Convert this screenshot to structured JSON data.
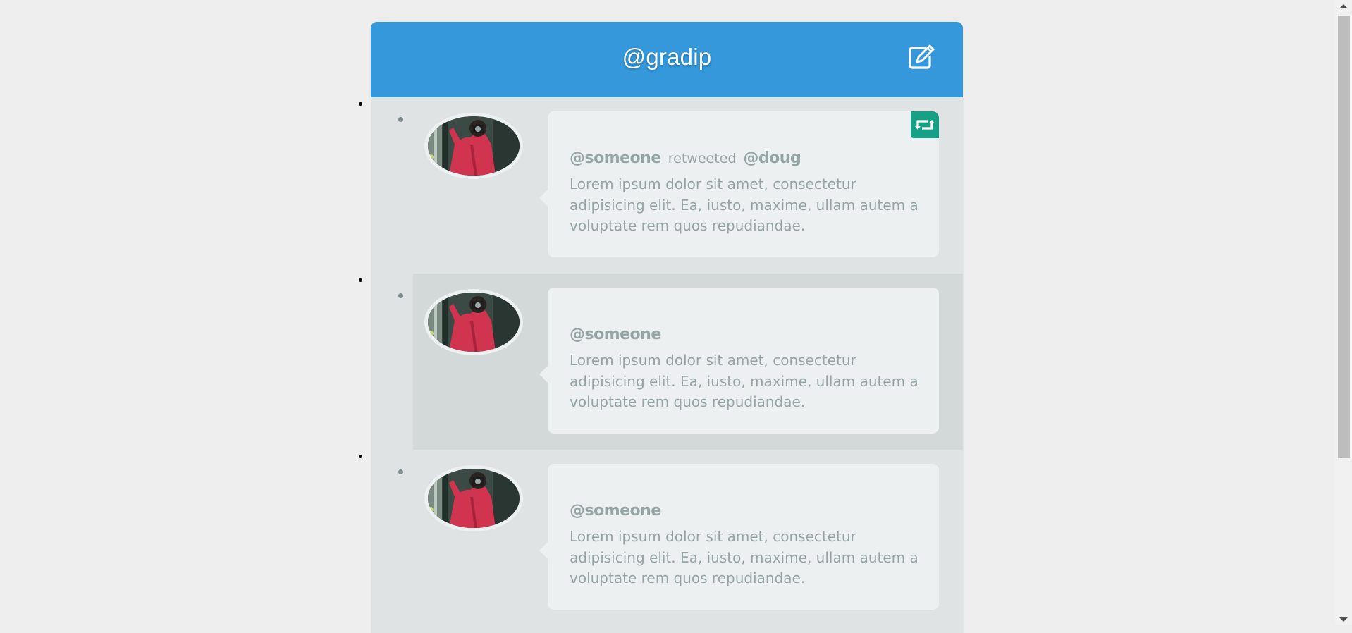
{
  "header": {
    "title": "@gradip",
    "compose_icon": "compose-edit-icon",
    "brand_color": "#3498db"
  },
  "timeline": {
    "tweets": [
      {
        "user": "@someone",
        "action": "retweeted",
        "retweeted_user": "@doug",
        "text": "Lorem ipsum dolor sit amet, consectetur adipisicing elit. Ea, iusto, maxime, ullam autem a voluptate rem quos repudiandae.",
        "is_retweet": true,
        "badge_icon": "retweet-icon",
        "badge_color": "#16a085"
      },
      {
        "user": "@someone",
        "text": "Lorem ipsum dolor sit amet, consectetur adipisicing elit. Ea, iusto, maxime, ullam autem a voluptate rem quos repudiandae.",
        "is_retweet": false
      },
      {
        "user": "@someone",
        "text": "Lorem ipsum dolor sit amet, consectetur adipisicing elit. Ea, iusto, maxime, ullam autem a voluptate rem quos repudiandae.",
        "is_retweet": false
      }
    ]
  }
}
